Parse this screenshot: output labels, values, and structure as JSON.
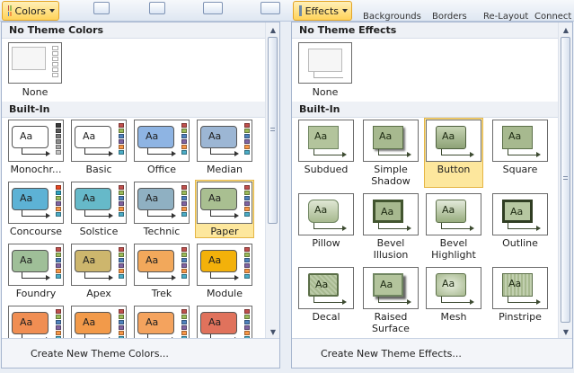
{
  "ribbon": {
    "colors_button": "Colors",
    "effects_button": "Effects",
    "backgrounds_label": "Backgrounds",
    "borders_label": "Borders",
    "relayout_label": "Re-Layout",
    "connect_label": "Connect"
  },
  "colors_panel": {
    "section_none": "No Theme Colors",
    "none_label": "None",
    "section_builtin": "Built-In",
    "footer": "Create New Theme Colors...",
    "sample_text": "Aa",
    "themes": [
      {
        "label": "Monochr...",
        "box": "#ffffff",
        "strip": [
          "#3a3a3a",
          "#5a5a5a",
          "#7a7a7a",
          "#8e8e8e",
          "#a8a8a8",
          "#c4c4c4"
        ]
      },
      {
        "label": "Basic",
        "box": "#ffffff",
        "strip": [
          "#c0504d",
          "#9bbb59",
          "#4f81bd",
          "#8064a2",
          "#f79646",
          "#4bacc6"
        ]
      },
      {
        "label": "Office",
        "box": "#8eb4e3",
        "strip": [
          "#c0504d",
          "#9bbb59",
          "#4f81bd",
          "#8064a2",
          "#f79646",
          "#4bacc6"
        ]
      },
      {
        "label": "Median",
        "box": "#9cb6d4",
        "strip": [
          "#c0504d",
          "#9bbb59",
          "#4f81bd",
          "#8064a2",
          "#f79646",
          "#4bacc6"
        ]
      },
      {
        "label": "Concourse",
        "box": "#5db2d5",
        "strip": [
          "#e64823",
          "#2da2bf",
          "#9bbb59",
          "#8064a2",
          "#f79646",
          "#4bacc6"
        ]
      },
      {
        "label": "Solstice",
        "box": "#66b9c9",
        "strip": [
          "#c0504d",
          "#9bbb59",
          "#4f81bd",
          "#8064a2",
          "#f79646",
          "#4bacc6"
        ]
      },
      {
        "label": "Technic",
        "box": "#8fb0c2",
        "strip": [
          "#c0504d",
          "#9bbb59",
          "#4f81bd",
          "#8064a2",
          "#f79646",
          "#4bacc6"
        ]
      },
      {
        "label": "Paper",
        "box": "#a9bf91",
        "strip": [
          "#c0504d",
          "#9bbb59",
          "#4f81bd",
          "#8064a2",
          "#f79646",
          "#4bacc6"
        ]
      },
      {
        "label": "Foundry",
        "box": "#9fbf98",
        "strip": [
          "#c0504d",
          "#9bbb59",
          "#4f81bd",
          "#8064a2",
          "#f79646",
          "#4bacc6"
        ]
      },
      {
        "label": "Apex",
        "box": "#cdb66d",
        "strip": [
          "#c0504d",
          "#9bbb59",
          "#4f81bd",
          "#8064a2",
          "#f79646",
          "#4bacc6"
        ]
      },
      {
        "label": "Trek",
        "box": "#f2a85b",
        "strip": [
          "#c0504d",
          "#9bbb59",
          "#4f81bd",
          "#8064a2",
          "#f79646",
          "#4bacc6"
        ]
      },
      {
        "label": "Module",
        "box": "#f3b10a",
        "strip": [
          "#c0504d",
          "#9bbb59",
          "#4f81bd",
          "#8064a2",
          "#f79646",
          "#4bacc6"
        ]
      },
      {
        "label": "",
        "box": "#f08e53",
        "strip": [
          "#c0504d",
          "#9bbb59",
          "#4f81bd",
          "#8064a2",
          "#f79646",
          "#4bacc6"
        ]
      },
      {
        "label": "",
        "box": "#f29a4a",
        "strip": [
          "#c0504d",
          "#9bbb59",
          "#4f81bd",
          "#8064a2",
          "#f79646",
          "#4bacc6"
        ]
      },
      {
        "label": "",
        "box": "#f4a35e",
        "strip": [
          "#c0504d",
          "#9bbb59",
          "#4f81bd",
          "#8064a2",
          "#f79646",
          "#4bacc6"
        ]
      },
      {
        "label": "",
        "box": "#e0725c",
        "strip": [
          "#c0504d",
          "#9bbb59",
          "#4f81bd",
          "#8064a2",
          "#f79646",
          "#4bacc6"
        ]
      }
    ],
    "selected_index": 7
  },
  "effects_panel": {
    "section_none": "No Theme Effects",
    "none_label": "None",
    "section_builtin": "Built-In",
    "footer": "Create New Theme Effects...",
    "sample_text": "Aa",
    "effects": [
      {
        "label": [
          "Subdued"
        ]
      },
      {
        "label": [
          "Simple",
          "Shadow"
        ]
      },
      {
        "label": [
          "Button"
        ]
      },
      {
        "label": [
          "Square"
        ]
      },
      {
        "label": [
          "Pillow"
        ]
      },
      {
        "label": [
          "Bevel",
          "Illusion"
        ]
      },
      {
        "label": [
          "Bevel",
          "Highlight"
        ]
      },
      {
        "label": [
          "Outline"
        ]
      },
      {
        "label": [
          "Decal"
        ]
      },
      {
        "label": [
          "Raised",
          "Surface"
        ]
      },
      {
        "label": [
          "Mesh"
        ]
      },
      {
        "label": [
          "Pinstripe"
        ]
      }
    ],
    "selected_index": 2
  }
}
